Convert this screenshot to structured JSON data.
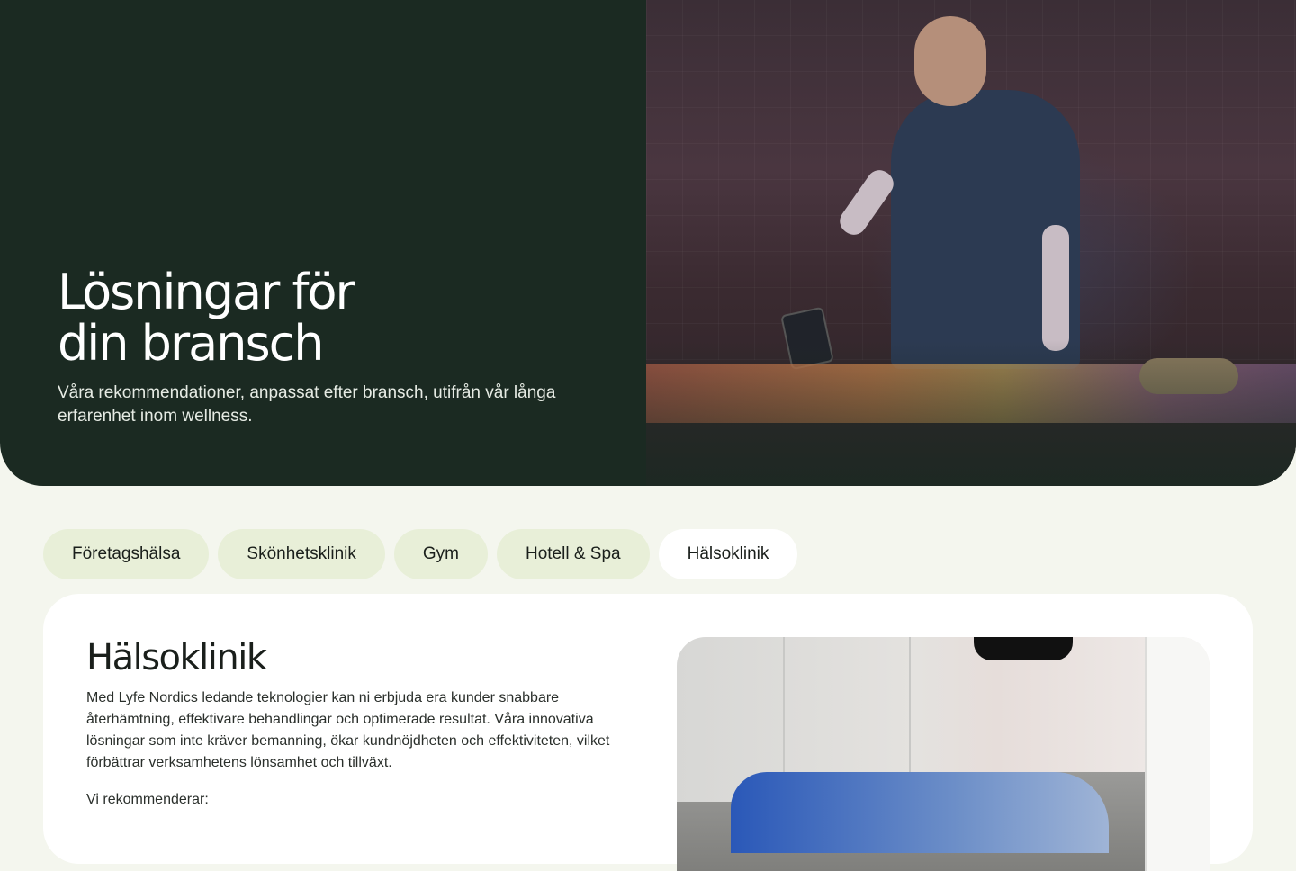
{
  "hero": {
    "title_line1": "Lösningar för",
    "title_line2": "din bransch",
    "subtitle": "Våra rekommendationer, anpassat efter bransch, utifrån vår långa erfarenhet inom wellness."
  },
  "tabs": [
    {
      "label": "Företagshälsa",
      "active": false
    },
    {
      "label": "Skönhetsklinik",
      "active": false
    },
    {
      "label": "Gym",
      "active": false
    },
    {
      "label": "Hotell & Spa",
      "active": false
    },
    {
      "label": "Hälsoklinik",
      "active": true
    }
  ],
  "card": {
    "title": "Hälsoklinik",
    "text": "Med Lyfe Nordics ledande teknologier kan ni erbjuda era kunder snabbare återhämtning, effektivare behandlingar och optimerade resultat. Våra innovativa lösningar som inte kräver bemanning, ökar kundnöjdheten och effektiviteten, vilket förbättrar verksamhetens lönsamhet och tillväxt.",
    "recommend_label": "Vi rekommenderar:"
  },
  "colors": {
    "hero_bg": "#1b2a22",
    "page_bg": "#f4f6ee",
    "tab_bg": "#e8efd8",
    "tab_active_bg": "#ffffff"
  }
}
